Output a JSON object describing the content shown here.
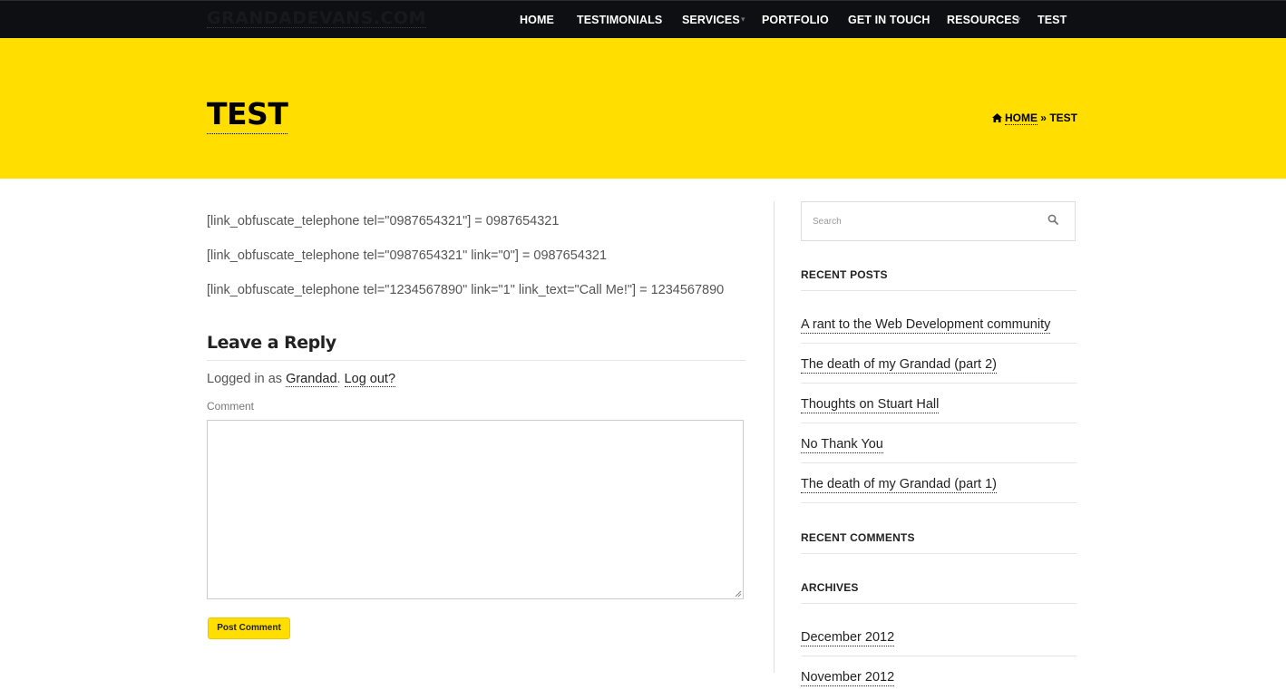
{
  "header": {
    "logo": "GRANDADEVANS.COM",
    "nav": [
      {
        "label": "HOME"
      },
      {
        "label": "TESTIMONIALS"
      },
      {
        "label": "SERVICES",
        "dropdown": true
      },
      {
        "label": "PORTFOLIO"
      },
      {
        "label": "GET IN TOUCH"
      },
      {
        "label": "RESOURCES",
        "dropdown": true
      },
      {
        "label": "TEST"
      }
    ],
    "caret_glyph": "▾"
  },
  "hero": {
    "title": "TEST",
    "breadcrumb": {
      "home_icon": "home-icon",
      "home": "HOME",
      "separator": "»",
      "current": "TEST"
    },
    "color": "#ffde00"
  },
  "content": {
    "paragraphs": [
      "[link_obfuscate_telephone tel=\"0987654321\"] = 0987654321",
      "[link_obfuscate_telephone tel=\"0987654321\" link=\"0\"] = 0987654321",
      "[link_obfuscate_telephone tel=\"1234567890\" link=\"1\" link_text=\"Call Me!\"] = 1234567890"
    ],
    "reply": {
      "title": "Leave a Reply",
      "logged_prefix": "Logged in as ",
      "user": "Grandad",
      "dot": ". ",
      "logout": "Log out?",
      "comment_label": "Comment",
      "comment_value": "",
      "submit": "Post Comment"
    }
  },
  "sidebar": {
    "search_placeholder": "Search",
    "search_icon": "search-icon",
    "recent_posts_title": "RECENT POSTS",
    "recent_posts": [
      "A rant to the Web Development community",
      "The death of my Grandad (part 2)",
      "Thoughts on Stuart Hall",
      "No Thank You",
      "The death of my Grandad (part 1)"
    ],
    "recent_comments_title": "RECENT COMMENTS",
    "archives_title": "ARCHIVES",
    "archives": [
      "December 2012",
      "November 2012"
    ]
  },
  "colors": {
    "accent": "#ffde00",
    "topbar": "#0d0f12",
    "text": "#555555",
    "heading": "#222222"
  }
}
